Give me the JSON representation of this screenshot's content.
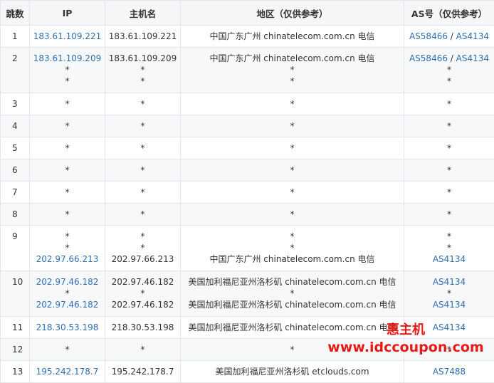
{
  "headers": {
    "hop": "跳数",
    "ip": "IP",
    "hostname": "主机名",
    "region": "地区（仅供参考）",
    "as": "AS号（仅供参考）"
  },
  "rows": [
    {
      "hop": "1",
      "lines": [
        {
          "ip": "183.61.109.221",
          "host": "183.61.109.221",
          "region": "中国广东广州 chinatelecom.com.cn 电信",
          "as": [
            "AS58466",
            "AS4134"
          ]
        }
      ]
    },
    {
      "hop": "2",
      "lines": [
        {
          "ip": "183.61.109.209",
          "host": "183.61.109.209",
          "region": "中国广东广州 chinatelecom.com.cn 电信",
          "as": [
            "AS58466",
            "AS4134"
          ]
        },
        {
          "ip": "*",
          "host": "*",
          "region": "*",
          "as": [
            "*"
          ]
        },
        {
          "ip": "*",
          "host": "*",
          "region": "*",
          "as": [
            "*"
          ]
        }
      ]
    },
    {
      "hop": "3",
      "lines": [
        {
          "ip": "*",
          "host": "*",
          "region": "*",
          "as": [
            "*"
          ]
        }
      ]
    },
    {
      "hop": "4",
      "lines": [
        {
          "ip": "*",
          "host": "*",
          "region": "*",
          "as": [
            "*"
          ]
        }
      ]
    },
    {
      "hop": "5",
      "lines": [
        {
          "ip": "*",
          "host": "*",
          "region": "*",
          "as": [
            "*"
          ]
        }
      ]
    },
    {
      "hop": "6",
      "lines": [
        {
          "ip": "*",
          "host": "*",
          "region": "*",
          "as": [
            "*"
          ]
        }
      ]
    },
    {
      "hop": "7",
      "lines": [
        {
          "ip": "*",
          "host": "*",
          "region": "*",
          "as": [
            "*"
          ]
        }
      ]
    },
    {
      "hop": "8",
      "lines": [
        {
          "ip": "*",
          "host": "*",
          "region": "*",
          "as": [
            "*"
          ]
        }
      ]
    },
    {
      "hop": "9",
      "lines": [
        {
          "ip": "*",
          "host": "*",
          "region": "*",
          "as": [
            "*"
          ]
        },
        {
          "ip": "*",
          "host": "*",
          "region": "*",
          "as": [
            "*"
          ]
        },
        {
          "ip": "202.97.66.213",
          "host": "202.97.66.213",
          "region": "中国广东广州 chinatelecom.com.cn 电信",
          "as": [
            "AS4134"
          ]
        }
      ]
    },
    {
      "hop": "10",
      "lines": [
        {
          "ip": "202.97.46.182",
          "host": "202.97.46.182",
          "region": "美国加利福尼亚州洛杉矶 chinatelecom.com.cn 电信",
          "as": [
            "AS4134"
          ]
        },
        {
          "ip": "*",
          "host": "*",
          "region": "*",
          "as": [
            "*"
          ]
        },
        {
          "ip": "202.97.46.182",
          "host": "202.97.46.182",
          "region": "美国加利福尼亚州洛杉矶 chinatelecom.com.cn 电信",
          "as": [
            "AS4134"
          ]
        }
      ]
    },
    {
      "hop": "11",
      "lines": [
        {
          "ip": "218.30.53.198",
          "host": "218.30.53.198",
          "region": "美国加利福尼亚州洛杉矶 chinatelecom.com.cn 电信",
          "as": [
            "AS4134"
          ]
        }
      ]
    },
    {
      "hop": "12",
      "lines": [
        {
          "ip": "*",
          "host": "*",
          "region": "*",
          "as": [
            "*"
          ]
        }
      ]
    },
    {
      "hop": "13",
      "lines": [
        {
          "ip": "195.242.178.7",
          "host": "195.242.178.7",
          "region": "美国加利福尼亚州洛杉矶 etclouds.com",
          "as": [
            "AS7488"
          ]
        }
      ]
    }
  ],
  "watermark": {
    "brand": "惠主机",
    "url": "www.idccoupon.com"
  },
  "colors": {
    "link": "#2f6fb3",
    "header_bg": "#f5f6f8",
    "alt_row_bg": "#f7f8fa",
    "border": "#e2e5ea",
    "watermark": "#e41b17"
  }
}
